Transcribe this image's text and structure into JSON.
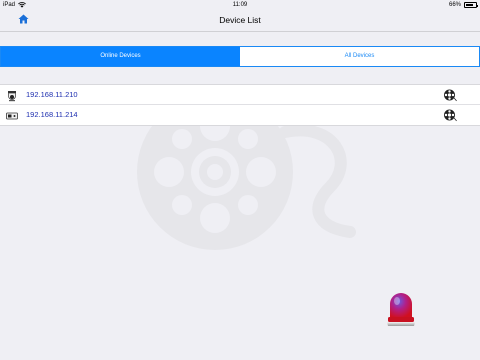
{
  "status_bar": {
    "carrier": "iPad",
    "time": "11:09",
    "battery": "66%",
    "battery_level": 0.66
  },
  "nav": {
    "title": "Device List",
    "home_icon": "home-icon"
  },
  "tabs": [
    {
      "label": "Online Devices",
      "selected": true
    },
    {
      "label": "All Devices",
      "selected": false
    }
  ],
  "devices": [
    {
      "ip": "192.168.11.210",
      "type_icon": "dome-camera-icon",
      "action_icon": "film-reel-icon"
    },
    {
      "ip": "192.168.11.214",
      "type_icon": "box-camera-icon",
      "action_icon": "film-reel-icon"
    }
  ],
  "alarm": {
    "icon": "alarm-siren-icon"
  },
  "colors": {
    "accent": "#0a84ff",
    "ip_text": "#1e2fb0",
    "background": "#efeff4"
  }
}
